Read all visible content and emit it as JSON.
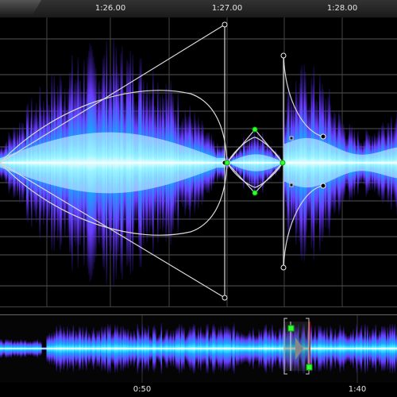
{
  "timeline": {
    "labels": [
      "1:26.00",
      "1:27.00",
      "1:28.00"
    ]
  },
  "overview_ruler": {
    "labels": [
      "0:50",
      "1:40"
    ]
  },
  "colors": {
    "waveform_core": "#e8ffff",
    "waveform_mid": "#19d7ff",
    "waveform_outer": "#5b2cff",
    "envelope_line": "#dcdcdc",
    "node_green": "#33ff33",
    "selection_red": "#cc0000"
  },
  "icons": {
    "envelope_point": "circle-handle",
    "selected_point": "green-circle-handle",
    "selection_handle": "green-square-handle"
  }
}
